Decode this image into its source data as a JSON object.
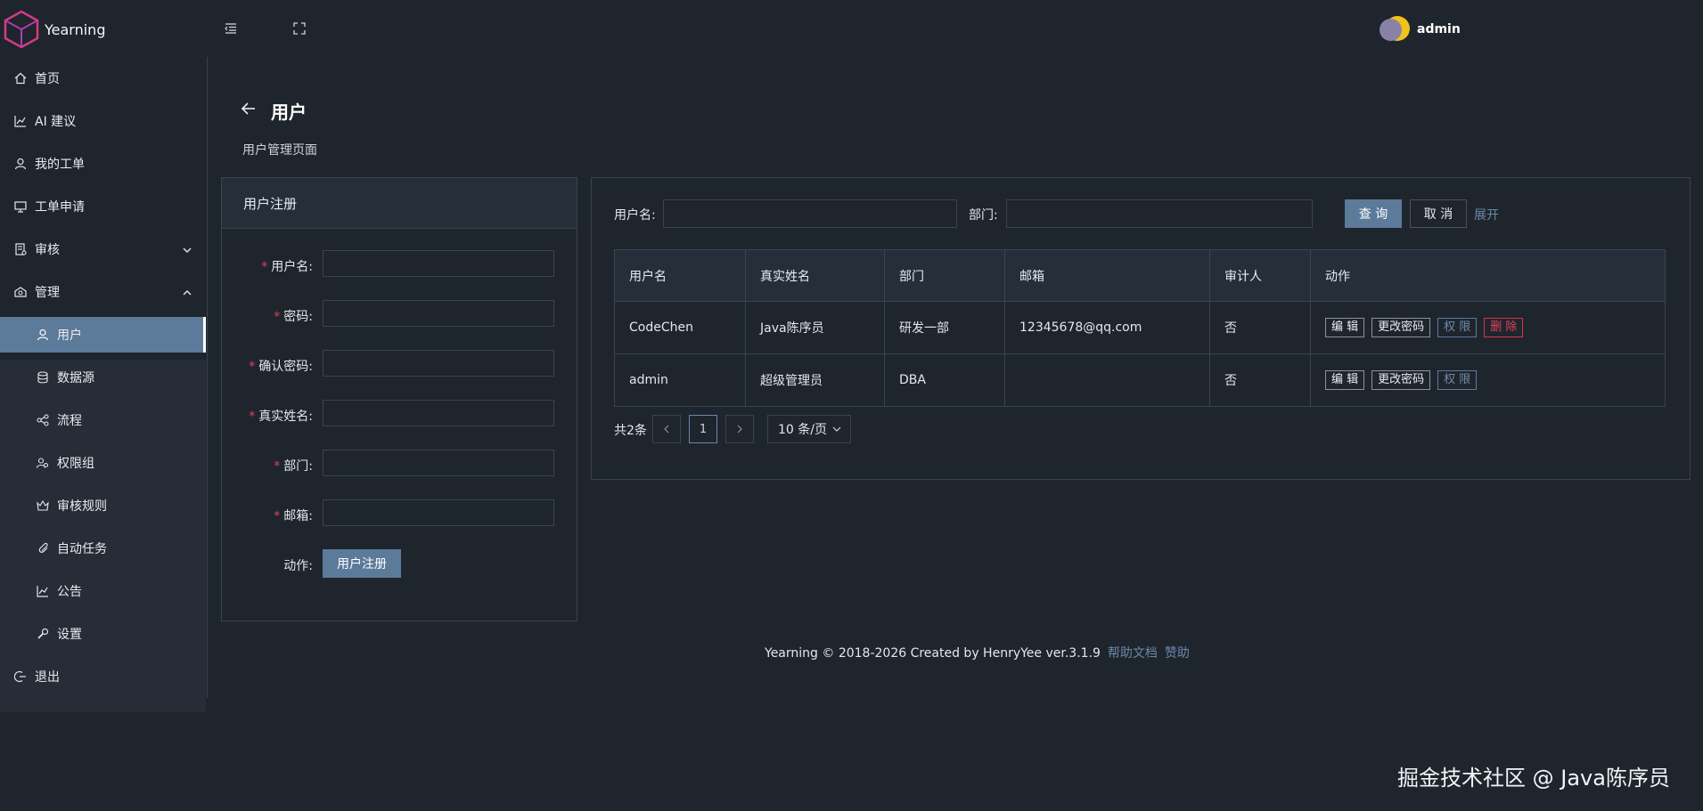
{
  "app": {
    "logo_text": "Yearning",
    "user_name": "admin"
  },
  "sidebar": {
    "items": [
      {
        "label": "首页",
        "icon": "home-icon"
      },
      {
        "label": "AI 建议",
        "icon": "chart-icon"
      },
      {
        "label": "我的工单",
        "icon": "user-icon"
      },
      {
        "label": "工单申请",
        "icon": "monitor-icon"
      },
      {
        "label": "审核",
        "icon": "audit-icon"
      },
      {
        "label": "管理",
        "icon": "manage-icon"
      }
    ],
    "sub_items": [
      {
        "label": "用户",
        "icon": "user-icon"
      },
      {
        "label": "数据源",
        "icon": "database-icon"
      },
      {
        "label": "流程",
        "icon": "flow-icon"
      },
      {
        "label": "权限组",
        "icon": "group-icon"
      },
      {
        "label": "审核规则",
        "icon": "rule-icon"
      },
      {
        "label": "自动任务",
        "icon": "task-icon"
      },
      {
        "label": "公告",
        "icon": "notice-icon"
      },
      {
        "label": "设置",
        "icon": "wrench-icon"
      }
    ],
    "logout": {
      "label": "退出",
      "icon": "logout-icon"
    }
  },
  "page": {
    "title": "用户",
    "subtitle": "用户管理页面"
  },
  "register": {
    "title": "用户注册",
    "fields": [
      {
        "label": "用户名:",
        "value": ""
      },
      {
        "label": "密码:",
        "value": ""
      },
      {
        "label": "确认密码:",
        "value": ""
      },
      {
        "label": "真实姓名:",
        "value": ""
      },
      {
        "label": "部门:",
        "value": ""
      },
      {
        "label": "邮箱:",
        "value": ""
      }
    ],
    "action_label": "动作:",
    "submit_label": "用户注册"
  },
  "search": {
    "username_label": "用户名:",
    "username_value": "",
    "dept_label": "部门:",
    "dept_value": "",
    "query_label": "查 询",
    "cancel_label": "取 消",
    "expand_label": "展开"
  },
  "table": {
    "columns": [
      "用户名",
      "真实姓名",
      "部门",
      "邮箱",
      "审计人",
      "动作"
    ],
    "rows": [
      {
        "username": "CodeChen",
        "real_name": "Java陈序员",
        "dept": "研发一部",
        "email": "12345678@qq.com",
        "auditor": "否",
        "actions": [
          "编 辑",
          "更改密码",
          "权 限",
          "删 除"
        ]
      },
      {
        "username": "admin",
        "real_name": "超级管理员",
        "dept": "DBA",
        "email": "",
        "auditor": "否",
        "actions": [
          "编 辑",
          "更改密码",
          "权 限"
        ]
      }
    ]
  },
  "pagination": {
    "total": "共2条",
    "current": "1",
    "page_size": "10 条/页"
  },
  "footer": {
    "text": "Yearning © 2018-2026 Created by HenryYee ver.3.1.9",
    "help_link": "帮助文档",
    "donate_link": "赞助"
  },
  "watermark": "掘金技术社区 @ Java陈序员",
  "colors": {
    "accent": "#5c7a9a",
    "danger": "#e0435a",
    "background": "#1f252d",
    "panel": "#262e39"
  }
}
